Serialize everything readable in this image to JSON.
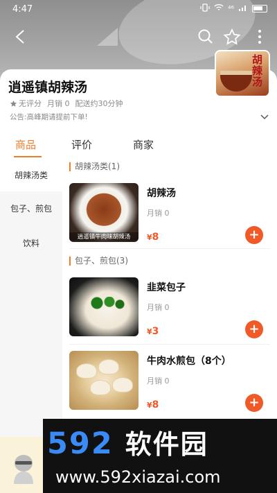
{
  "status_bar": {
    "time": "4:47",
    "signal_text": "⁴⁶"
  },
  "shop": {
    "logo_text": "胡辣汤",
    "name": "逍遥镇胡辣汤",
    "rating": "无评分",
    "monthly_sales": "月销 0",
    "delivery": "配送约30分钟",
    "notice": "公告:高峰期请提前下单!"
  },
  "tabs": [
    {
      "label": "商品",
      "active": true
    },
    {
      "label": "评价",
      "active": false
    },
    {
      "label": "商家",
      "active": false
    }
  ],
  "sidebar": {
    "items": [
      {
        "label": "胡辣汤类",
        "active": true
      },
      {
        "label": "包子、煎包",
        "active": false
      },
      {
        "label": "饮料",
        "active": false
      }
    ]
  },
  "menu": {
    "categories": [
      {
        "title": "胡辣汤类(1)",
        "items": [
          {
            "name": "胡辣汤",
            "sales": "月销 0",
            "currency": "¥",
            "price": "8",
            "thumb_caption": "逍遥镇牛肉味胡辣汤"
          }
        ]
      },
      {
        "title": "包子、煎包(3)",
        "items": [
          {
            "name": "韭菜包子",
            "sales": "月销 0",
            "currency": "¥",
            "price": "3"
          },
          {
            "name": "牛肉水煎包（8个）",
            "sales": "月销 0",
            "currency": "¥",
            "price": "8"
          }
        ]
      }
    ],
    "add_symbol": "+"
  },
  "watermark": {
    "logo_number": "592",
    "logo_text": "软件园",
    "url": "www.592xiazai.com"
  },
  "colors": {
    "accent": "#f07c2a",
    "price": "#f05a28",
    "watermark_blue": "#3a8bf5"
  }
}
